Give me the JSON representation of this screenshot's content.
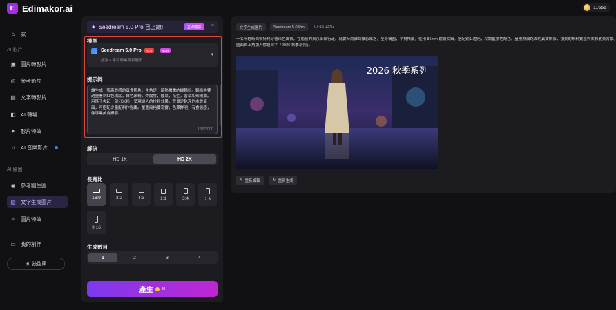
{
  "app": {
    "name": "Edimakor.ai",
    "logo_letter": "E"
  },
  "credits": "11655",
  "sidebar": {
    "home": "家",
    "video_section": "AI 影片",
    "video_items": [
      "圖片轉影片",
      "參考影片",
      "文字轉影片",
      "AI 轉場",
      "影片特效",
      "AI 音樂影片"
    ],
    "image_section": "AI 繪圖",
    "image_items": [
      "參考圖生圖",
      "文字生成圖片",
      "圖片特效"
    ],
    "my_creations": "我的創作",
    "workspace": "技能庫",
    "active_item": "文字生成圖片"
  },
  "banner": {
    "text": "Seedream 5.0 Pro 已上線!",
    "cta": "立即體驗",
    "close": "×"
  },
  "model": {
    "label": "模型",
    "name": "Seedream 5.0 Pro",
    "hot": "HOT",
    "new": "NEW",
    "description": "超強人像和商業實景展示"
  },
  "prompt": {
    "label": "提示詞",
    "text": "讓生成一張高質感的真食照片。主角是一碗熱騰騰的蠔麵粉。麵條中要適量看到紅色湯底，白色米粉，炸腐竹，酸菜，花生，香草和辣椒油。用筷子夾起一部分米粉，呈現誘人的拉粉效果。背景是乾淨的木質桌面，可搭配少量配料作點綴。整體風格要寫實，色澤鮮明，有食慾感，像專業美食攝影。",
    "count": "132/2000"
  },
  "resolution": {
    "label": "解決",
    "options": [
      "HD 1K",
      "HD 2K"
    ],
    "selected": "HD 2K"
  },
  "aspect": {
    "label": "長寬比",
    "options": [
      "16:9",
      "3:2",
      "4:3",
      "1:1",
      "3:4",
      "2:3",
      "9:16"
    ],
    "selected": "16:9"
  },
  "count": {
    "label": "生成數目",
    "options": [
      "1",
      "2",
      "3",
      "4"
    ],
    "selected": "1"
  },
  "generate": {
    "label": "產生",
    "cost": "80"
  },
  "result": {
    "tag_type": "文字生成圖片",
    "tag_model": "Seedream 5.0 Pro",
    "time": "07-15 13:02",
    "description": "一名年輕時尚模特兒穿著米色風衣，在雨夜的東京街頭行走。寫實時尚雜誌攝影風格，全身構圖，平視角度，使用 85mm 鏡頭拍攝。搭配霓虹燈光，冷調藍紫色配色。呈現濕潤路面的真實倒影，淺景的布料質感與柔和散景背景。圖面右上角加入標題白字「2026 秋季系列」。",
    "image_title": "2026 秋季系列",
    "edit": "重新編輯",
    "regenerate": "重新生成"
  }
}
